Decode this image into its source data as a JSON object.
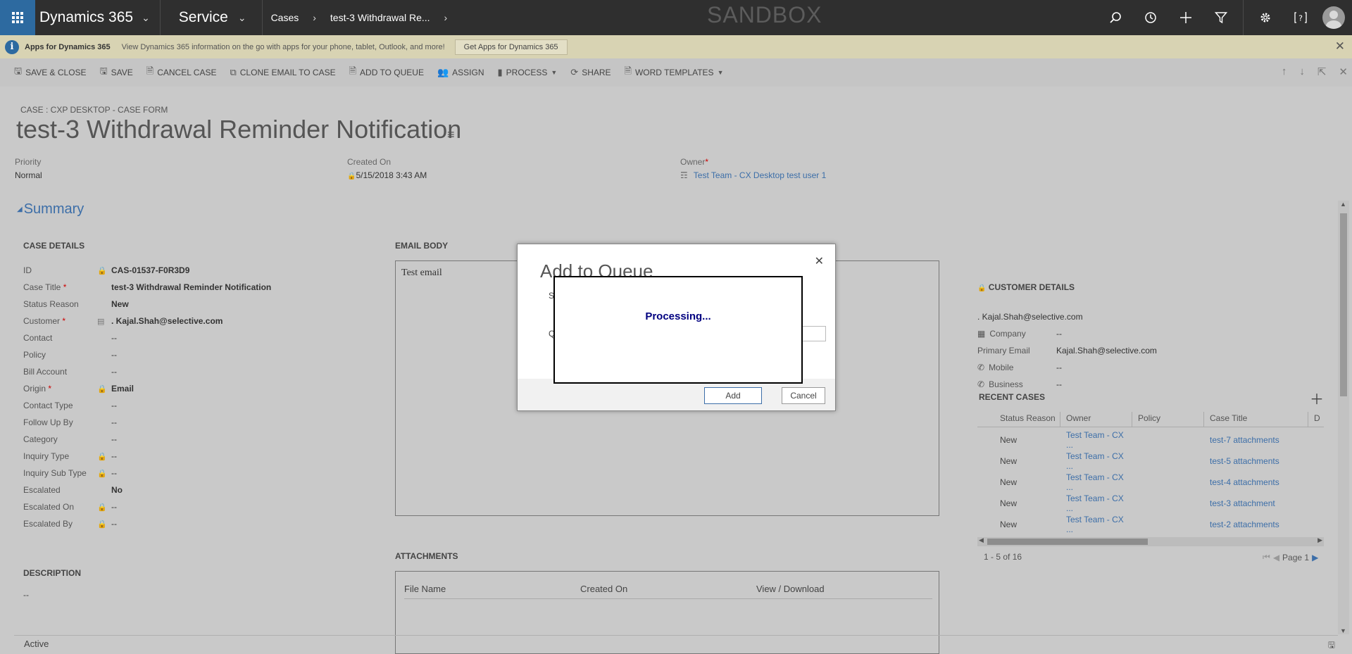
{
  "nav": {
    "brand": "Dynamics 365",
    "app": "Service",
    "crumb1": "Cases",
    "crumb2": "test-3 Withdrawal Re...",
    "env": "SANDBOX"
  },
  "notice": {
    "title": "Apps for Dynamics 365",
    "text": "View Dynamics 365 information on the go with apps for your phone, tablet, Outlook, and more!",
    "button": "Get Apps for Dynamics 365"
  },
  "commands": [
    {
      "label": "SAVE & CLOSE",
      "icon": "save-close-icon"
    },
    {
      "label": "SAVE",
      "icon": "save-icon"
    },
    {
      "label": "CANCEL CASE",
      "icon": "cancel-case-icon"
    },
    {
      "label": "CLONE EMAIL TO CASE",
      "icon": "clone-icon"
    },
    {
      "label": "ADD TO QUEUE",
      "icon": "queue-icon"
    },
    {
      "label": "ASSIGN",
      "icon": "assign-icon"
    },
    {
      "label": "PROCESS",
      "icon": "process-icon"
    },
    {
      "label": "SHARE",
      "icon": "share-icon"
    },
    {
      "label": "WORD TEMPLATES",
      "icon": "word-icon"
    }
  ],
  "header": {
    "form_label": "CASE : CXP DESKTOP - CASE FORM",
    "title": "test-3 Withdrawal Reminder Notification",
    "priority_label": "Priority",
    "priority": "Normal",
    "created_label": "Created On",
    "created": "5/15/2018  3:43 AM",
    "owner_label": "Owner",
    "owner": "Test Team - CX Desktop test user 1"
  },
  "summary_label": "Summary",
  "case_details": {
    "heading": "CASE DETAILS",
    "rows": [
      {
        "label": "ID",
        "value": "CAS-01537-F0R3D9"
      },
      {
        "label": "Case Title",
        "value": "test-3 Withdrawal Reminder Notification"
      },
      {
        "label": "Status Reason",
        "value": "New"
      },
      {
        "label": "Customer",
        "value": ". Kajal.Shah@selective.com"
      },
      {
        "label": "Contact",
        "value": "--"
      },
      {
        "label": "Policy",
        "value": "--"
      },
      {
        "label": "Bill Account",
        "value": "--"
      },
      {
        "label": "Origin",
        "value": "Email"
      },
      {
        "label": "Contact Type",
        "value": "--"
      },
      {
        "label": "Follow Up By",
        "value": "--"
      },
      {
        "label": "Category",
        "value": "--"
      },
      {
        "label": "Inquiry Type",
        "value": "--"
      },
      {
        "label": "Inquiry Sub Type",
        "value": "--"
      },
      {
        "label": "Escalated",
        "value": "No"
      },
      {
        "label": "Escalated On",
        "value": "--"
      },
      {
        "label": "Escalated By",
        "value": "--"
      }
    ]
  },
  "description": {
    "heading": "DESCRIPTION",
    "value": "--"
  },
  "email": {
    "heading": "EMAIL BODY",
    "body": "Test email"
  },
  "attachments": {
    "heading": "ATTACHMENTS",
    "columns": [
      "File Name",
      "Created On",
      "View / Download"
    ]
  },
  "customer": {
    "heading": "CUSTOMER DETAILS",
    "name": ". Kajal.Shah@selective.com",
    "rows": [
      {
        "label": "Company",
        "value": "--"
      },
      {
        "label": "Primary Email",
        "value": "Kajal.Shah@selective.com"
      },
      {
        "label": "Mobile",
        "value": "--"
      },
      {
        "label": "Business",
        "value": "--"
      }
    ]
  },
  "recent_cases": {
    "heading": "RECENT CASES",
    "columns": [
      "Status Reason",
      "Owner",
      "Policy",
      "Case Title",
      "D"
    ],
    "rows": [
      {
        "status": "New",
        "owner": "Test Team - CX ...",
        "policy": "",
        "title": "test-7 attachments"
      },
      {
        "status": "New",
        "owner": "Test Team - CX ...",
        "policy": "",
        "title": "test-5 attachments"
      },
      {
        "status": "New",
        "owner": "Test Team - CX ...",
        "policy": "",
        "title": "test-4 attachments"
      },
      {
        "status": "New",
        "owner": "Test Team - CX ...",
        "policy": "",
        "title": "test-3 attachment"
      },
      {
        "status": "New",
        "owner": "Test Team - CX ...",
        "policy": "",
        "title": "test-2 attachments"
      }
    ],
    "range": "1 - 5 of 16",
    "page": "Page 1"
  },
  "status": "Active",
  "dialog": {
    "title": "Add to Queue",
    "frag1": "S",
    "frag2": "Q",
    "processing": "Processing...",
    "add": "Add",
    "cancel": "Cancel"
  }
}
